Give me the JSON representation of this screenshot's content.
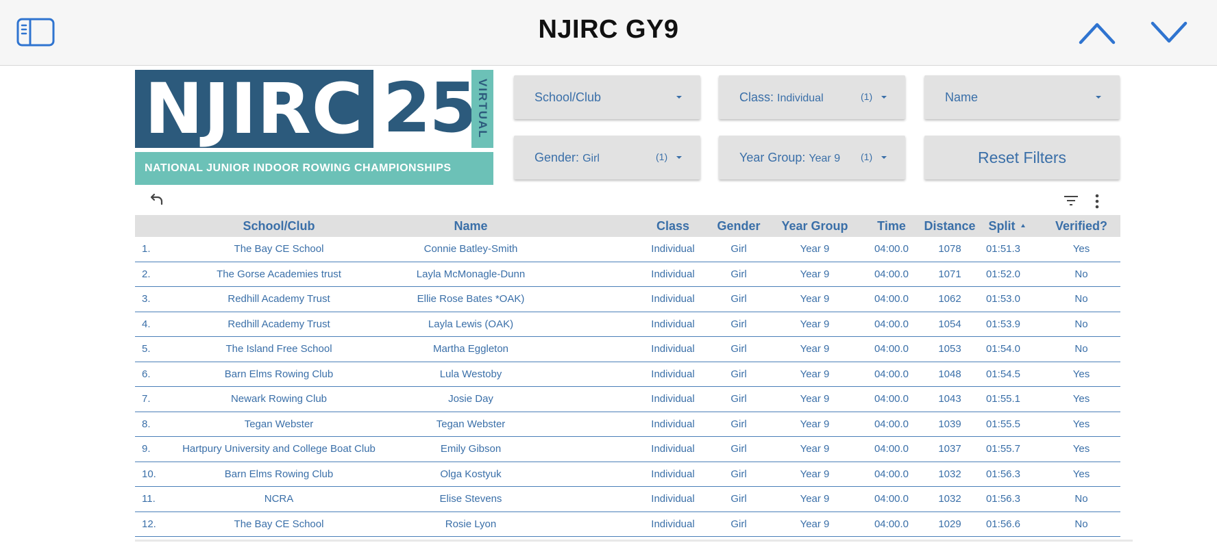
{
  "header": {
    "title": "NJIRC GY9",
    "sidebar_icon": "sidebar-toggle-icon",
    "up_icon": "chevron-up-icon",
    "down_icon": "chevron-down-icon"
  },
  "logo": {
    "text_main": "NJIRC",
    "text_number": "25",
    "text_side": "VIRTUAL",
    "text_sub": "NATIONAL JUNIOR INDOOR ROWING CHAMPIONSHIPS"
  },
  "filters": {
    "school": {
      "label": "School/Club"
    },
    "class": {
      "label": "Class:",
      "value": "Individual",
      "count": "(1)"
    },
    "name": {
      "label": "Name"
    },
    "gender": {
      "label": "Gender:",
      "value": "Girl",
      "count": "(1)"
    },
    "year": {
      "label": "Year Group:",
      "value": "Year 9",
      "count": "(1)"
    },
    "reset": {
      "label": "Reset Filters"
    }
  },
  "toolbar": {
    "undo_icon": "undo-icon",
    "filter_icon": "filter-icon",
    "more_icon": "more-vertical-icon"
  },
  "table": {
    "columns": [
      "School/Club",
      "Name",
      "Class",
      "Gender",
      "Year Group",
      "Time",
      "Distance",
      "Split",
      "Verified?"
    ],
    "sorted_column": "Split",
    "rows": [
      {
        "rank": "1.",
        "school": "The Bay CE School",
        "name": "Connie Batley-Smith",
        "class": "Individual",
        "gender": "Girl",
        "year": "Year 9",
        "time": "04:00.0",
        "distance": "1078",
        "split": "01:51.3",
        "verified": "Yes"
      },
      {
        "rank": "2.",
        "school": "The Gorse Academies trust",
        "name": "Layla McMonagle-Dunn",
        "class": "Individual",
        "gender": "Girl",
        "year": "Year 9",
        "time": "04:00.0",
        "distance": "1071",
        "split": "01:52.0",
        "verified": "No"
      },
      {
        "rank": "3.",
        "school": "Redhill Academy Trust",
        "name": "Ellie Rose Bates *OAK)",
        "class": "Individual",
        "gender": "Girl",
        "year": "Year 9",
        "time": "04:00.0",
        "distance": "1062",
        "split": "01:53.0",
        "verified": "No"
      },
      {
        "rank": "4.",
        "school": "Redhill Academy Trust",
        "name": "Layla Lewis (OAK)",
        "class": "Individual",
        "gender": "Girl",
        "year": "Year 9",
        "time": "04:00.0",
        "distance": "1054",
        "split": "01:53.9",
        "verified": "No"
      },
      {
        "rank": "5.",
        "school": "The Island Free School",
        "name": "Martha Eggleton",
        "class": "Individual",
        "gender": "Girl",
        "year": "Year 9",
        "time": "04:00.0",
        "distance": "1053",
        "split": "01:54.0",
        "verified": "No"
      },
      {
        "rank": "6.",
        "school": "Barn Elms Rowing Club",
        "name": "Lula Westoby",
        "class": "Individual",
        "gender": "Girl",
        "year": "Year 9",
        "time": "04:00.0",
        "distance": "1048",
        "split": "01:54.5",
        "verified": "Yes"
      },
      {
        "rank": "7.",
        "school": "Newark Rowing Club",
        "name": "Josie Day",
        "class": "Individual",
        "gender": "Girl",
        "year": "Year 9",
        "time": "04:00.0",
        "distance": "1043",
        "split": "01:55.1",
        "verified": "Yes"
      },
      {
        "rank": "8.",
        "school": "Tegan Webster",
        "name": "Tegan Webster",
        "class": "Individual",
        "gender": "Girl",
        "year": "Year 9",
        "time": "04:00.0",
        "distance": "1039",
        "split": "01:55.5",
        "verified": "Yes"
      },
      {
        "rank": "9.",
        "school": "Hartpury University and College Boat Club",
        "name": "Emily Gibson",
        "class": "Individual",
        "gender": "Girl",
        "year": "Year 9",
        "time": "04:00.0",
        "distance": "1037",
        "split": "01:55.7",
        "verified": "Yes"
      },
      {
        "rank": "10.",
        "school": "Barn Elms Rowing Club",
        "name": "Olga Kostyuk",
        "class": "Individual",
        "gender": "Girl",
        "year": "Year 9",
        "time": "04:00.0",
        "distance": "1032",
        "split": "01:56.3",
        "verified": "Yes"
      },
      {
        "rank": "11.",
        "school": "NCRA",
        "name": "Elise Stevens",
        "class": "Individual",
        "gender": "Girl",
        "year": "Year 9",
        "time": "04:00.0",
        "distance": "1032",
        "split": "01:56.3",
        "verified": "No"
      },
      {
        "rank": "12.",
        "school": "The Bay CE School",
        "name": "Rosie Lyon",
        "class": "Individual",
        "gender": "Girl",
        "year": "Year 9",
        "time": "04:00.0",
        "distance": "1029",
        "split": "01:56.6",
        "verified": "No"
      }
    ]
  },
  "colors": {
    "accent": "#3a6fa8",
    "logo_dark": "#2c5a7c",
    "logo_teal": "#6cc1b7",
    "header_bg": "#f6f6f6",
    "filter_bg": "#e2e2e2",
    "table_header_bg": "#e0e0e0"
  }
}
